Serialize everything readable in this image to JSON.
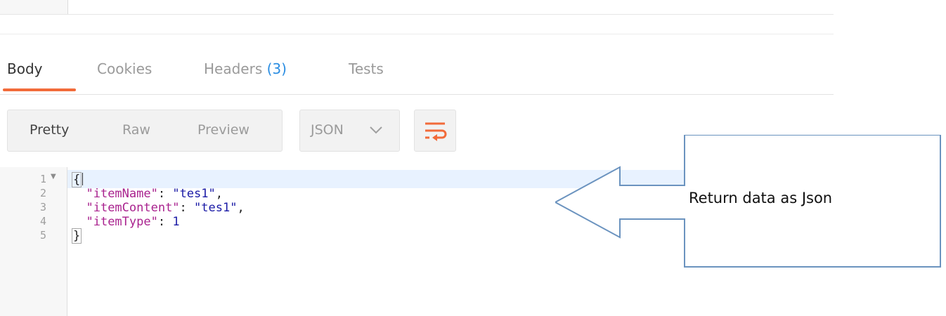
{
  "tabs": [
    {
      "label": "Body"
    },
    {
      "label": "Cookies"
    },
    {
      "label": "Headers",
      "count": "(3)"
    },
    {
      "label": "Tests"
    }
  ],
  "view_modes": {
    "pretty": "Pretty",
    "raw": "Raw",
    "preview": "Preview"
  },
  "format": {
    "selected": "JSON"
  },
  "code": {
    "line_numbers": [
      "1",
      "2",
      "3",
      "4",
      "5"
    ],
    "open_brace": "{",
    "close_brace": "}",
    "lines": [
      {
        "key": "\"itemName\"",
        "value": "\"tes1\"",
        "trail": ","
      },
      {
        "key": "\"itemContent\"",
        "value": "\"tes1\"",
        "trail": ","
      },
      {
        "key": "\"itemType\"",
        "value": "1",
        "trail": ""
      }
    ]
  },
  "annotation": {
    "text": "Return data as Json"
  },
  "colors": {
    "accent": "#f26b3a",
    "badge": "#2a8de2",
    "json_key": "#a9228e",
    "json_value": "#1a1aa6",
    "annotation_stroke": "#6b93bf"
  },
  "icons": {
    "chevron": "chevron-down-icon",
    "wrap": "wrap-lines-icon",
    "fold": "fold-arrow-icon"
  }
}
